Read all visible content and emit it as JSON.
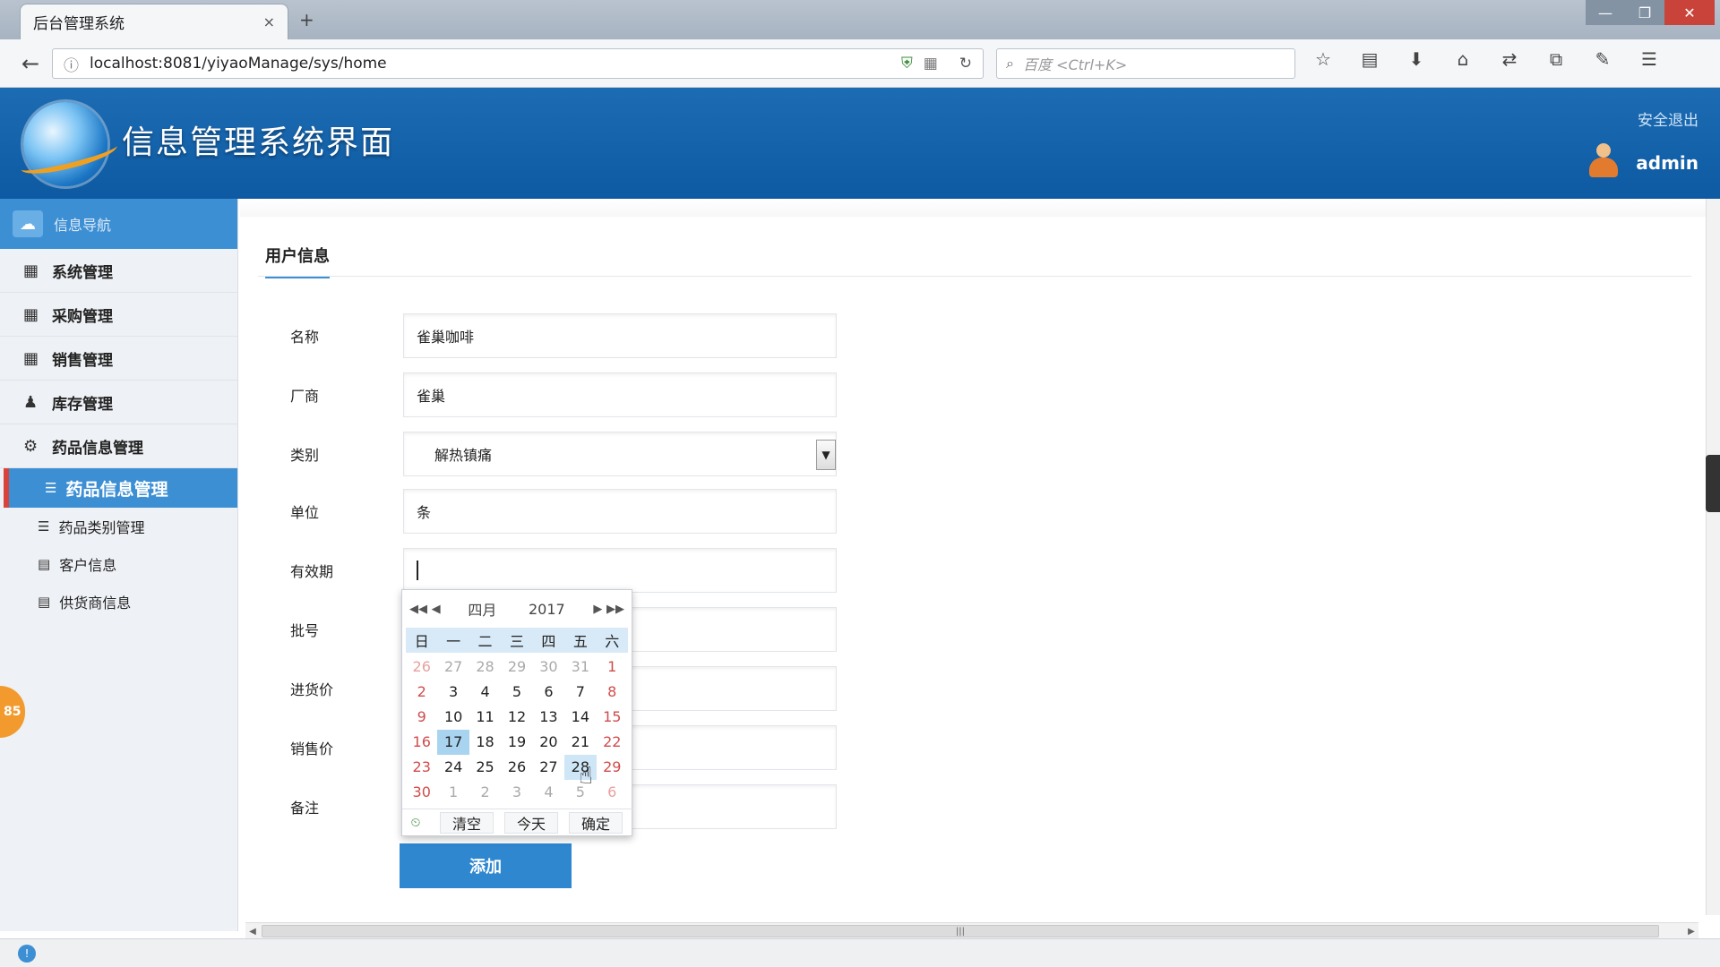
{
  "browser": {
    "tab_title": "后台管理系统",
    "tab_close": "×",
    "new_tab": "+",
    "url": "localhost:8081/yiyaoManage/sys/home",
    "search_placeholder": "百度 <Ctrl+K>",
    "window_buttons": {
      "minimize": "—",
      "maximize": "❐",
      "close": "✕"
    },
    "toolbar_icons": [
      "star-icon",
      "reader-icon",
      "download-icon",
      "home-icon",
      "translate-icon",
      "screenshot-icon",
      "tools-icon",
      "menu-icon"
    ]
  },
  "header": {
    "title": "信息管理系统界面",
    "logout": "安全退出",
    "username": "admin"
  },
  "sidebar": {
    "top_label": "信息导航",
    "items": [
      {
        "label": "系统管理",
        "icon": "calendar-icon"
      },
      {
        "label": "采购管理",
        "icon": "calendar-icon"
      },
      {
        "label": "销售管理",
        "icon": "calendar-icon"
      },
      {
        "label": "库存管理",
        "icon": "user-icon"
      },
      {
        "label": "药品信息管理",
        "icon": "gears-icon"
      }
    ],
    "sub_items": [
      {
        "label": "药品信息管理",
        "active": true
      },
      {
        "label": "药品类别管理"
      },
      {
        "label": "客户信息"
      },
      {
        "label": "供货商信息"
      }
    ],
    "badge": "85"
  },
  "form": {
    "section_title": "用户信息",
    "fields": [
      {
        "label": "名称",
        "value": "雀巢咖啡"
      },
      {
        "label": "厂商",
        "value": "雀巢"
      },
      {
        "label": "类别",
        "value": "解热镇痛"
      },
      {
        "label": "单位",
        "value": "条"
      },
      {
        "label": "有效期",
        "value": ""
      },
      {
        "label": "批号",
        "value": ""
      },
      {
        "label": "进货价",
        "value": ""
      },
      {
        "label": "销售价",
        "value": ""
      },
      {
        "label": "备注",
        "value": ""
      }
    ],
    "submit_label": "添加"
  },
  "datepicker": {
    "month": "四月",
    "year": "2017",
    "weekdays": [
      "日",
      "一",
      "二",
      "三",
      "四",
      "五",
      "六"
    ],
    "weeks": [
      [
        "26",
        "27",
        "28",
        "29",
        "30",
        "31",
        "1"
      ],
      [
        "2",
        "3",
        "4",
        "5",
        "6",
        "7",
        "8"
      ],
      [
        "9",
        "10",
        "11",
        "12",
        "13",
        "14",
        "15"
      ],
      [
        "16",
        "17",
        "18",
        "19",
        "20",
        "21",
        "22"
      ],
      [
        "23",
        "24",
        "25",
        "26",
        "27",
        "28",
        "29"
      ],
      [
        "30",
        "1",
        "2",
        "3",
        "4",
        "5",
        "6"
      ]
    ],
    "selected_day": "17",
    "hover_day": "28",
    "buttons": {
      "clear": "清空",
      "today": "今天",
      "ok": "确定"
    }
  }
}
